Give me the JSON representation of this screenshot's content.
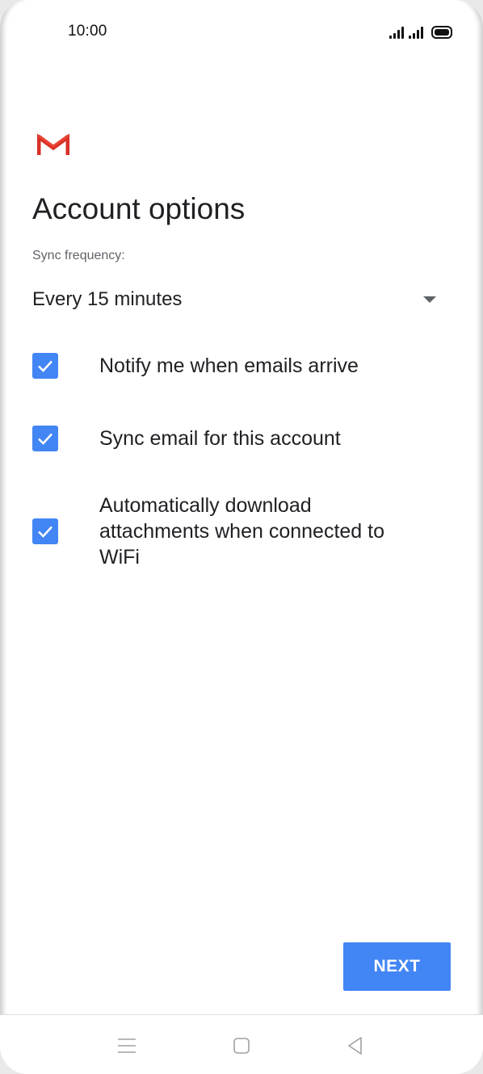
{
  "status_bar": {
    "time": "10:00"
  },
  "screen": {
    "title": "Account options",
    "sync_label": "Sync frequency:",
    "sync_value": "Every 15 minutes",
    "options": [
      {
        "label": "Notify me when emails arrive",
        "checked": true
      },
      {
        "label": "Sync email for this account",
        "checked": true
      },
      {
        "label": "Automatically download attachments when connected to WiFi",
        "checked": true
      }
    ],
    "next_label": "NEXT"
  },
  "colors": {
    "accent": "#4285f4",
    "gmail_red": "#d93025",
    "text_primary": "#202124",
    "text_secondary": "#5f6368"
  },
  "icons": {
    "logo": "gmail-logo-icon",
    "dropdown": "dropdown-arrow-icon",
    "nav": [
      "menu-icon",
      "home-icon",
      "back-icon"
    ]
  }
}
